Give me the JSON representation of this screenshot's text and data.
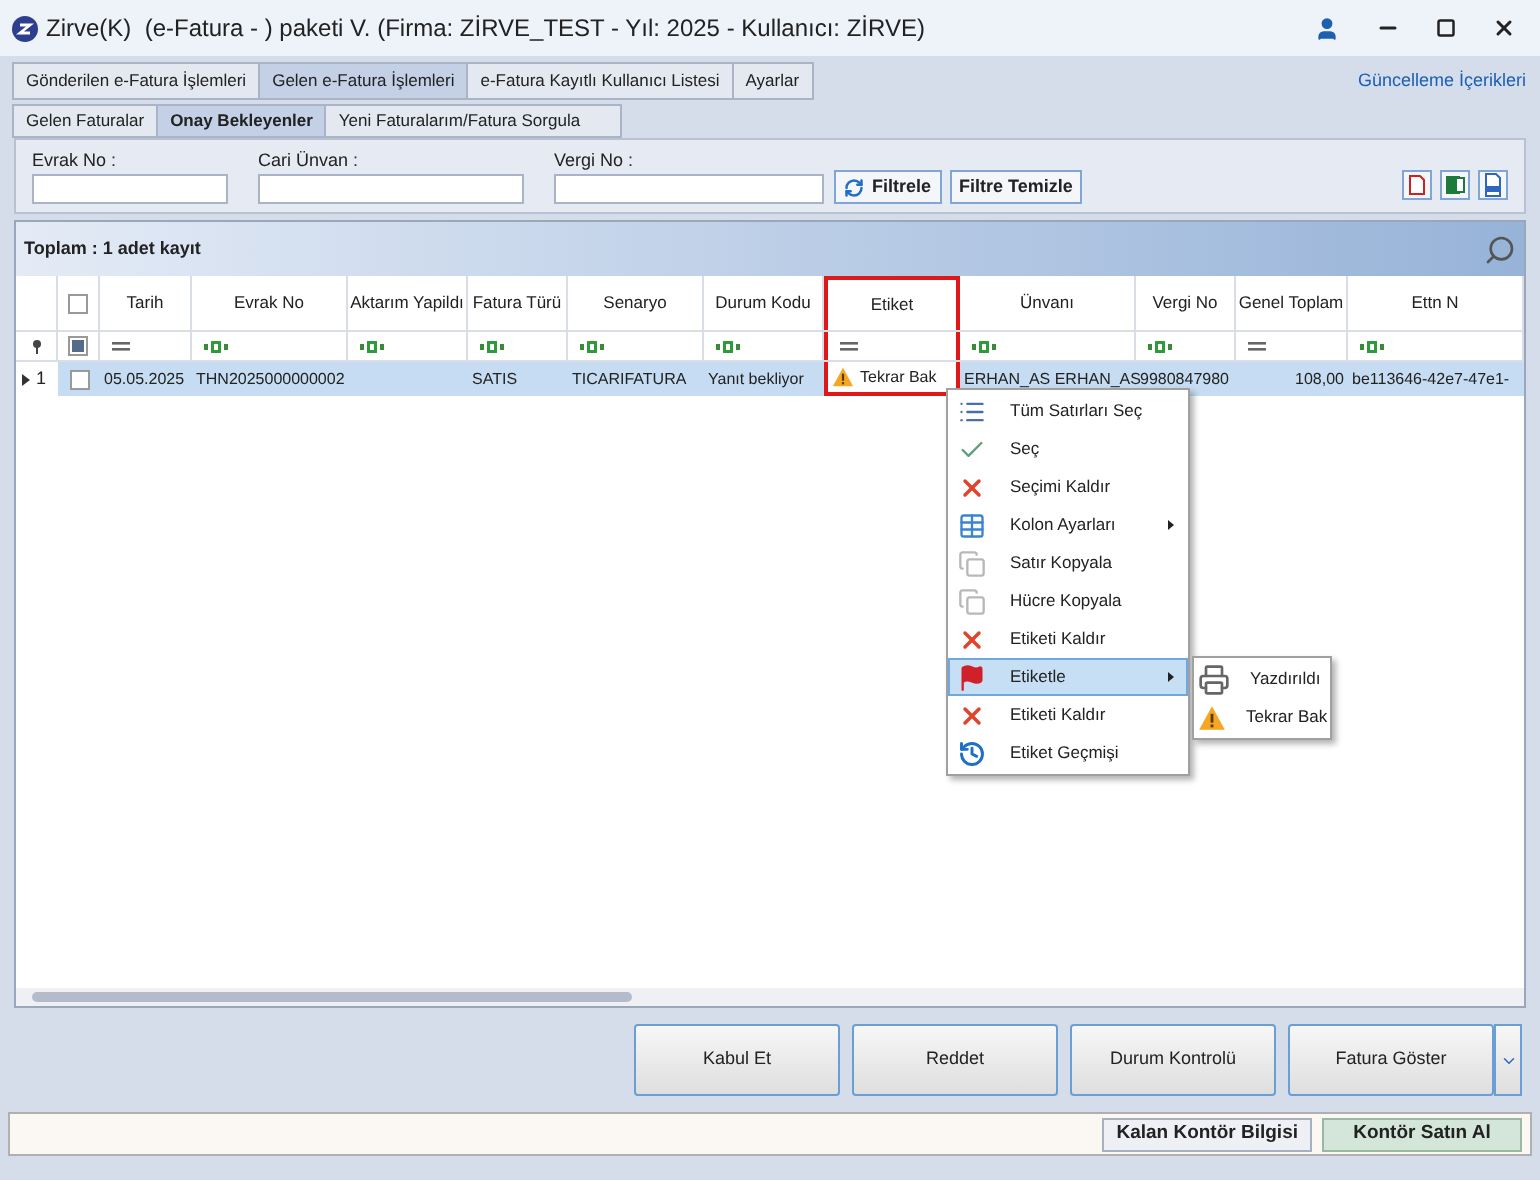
{
  "window": {
    "title": "Zirve(K)  (e-Fatura - ) paketi V. (Firma: ZİRVE_TEST - Yıl: 2025 - Kullanıcı: ZİRVE)"
  },
  "main_tabs": [
    {
      "label": "Gönderilen e-Fatura İşlemleri",
      "selected": false
    },
    {
      "label": "Gelen e-Fatura İşlemleri",
      "selected": true
    },
    {
      "label": "e-Fatura Kayıtlı Kullanıcı Listesi",
      "selected": false
    },
    {
      "label": "Ayarlar",
      "selected": false
    }
  ],
  "update_link": "Güncelleme İçerikleri",
  "sub_tabs": [
    {
      "label": "Gelen Faturalar",
      "selected": false
    },
    {
      "label": "Onay Bekleyenler",
      "selected": true
    },
    {
      "label": "Yeni Faturalarım/Fatura Sorgula",
      "selected": false
    }
  ],
  "filters": [
    {
      "label": "Evrak No :"
    },
    {
      "label": "Cari Ünvan :"
    },
    {
      "label": "Vergi No :"
    }
  ],
  "filter_buttons": [
    "Filtrele",
    "Filtre Temizle"
  ],
  "total": "Toplam : 1 adet kayıt",
  "select_all": {
    "checked": false
  },
  "filter_checkbox": {
    "checked": true
  },
  "columns": [
    {
      "label": "Tarih",
      "kind": "equals",
      "highlighted": false
    },
    {
      "label": "Evrak No",
      "kind": "text",
      "highlighted": false
    },
    {
      "label": "Aktarım Yapildı",
      "kind": "text",
      "highlighted": false
    },
    {
      "label": "Fatura Türü",
      "kind": "text",
      "highlighted": false
    },
    {
      "label": "Senaryo",
      "kind": "text",
      "highlighted": false
    },
    {
      "label": "Durum Kodu",
      "kind": "text",
      "highlighted": false
    },
    {
      "label": "Etiket",
      "kind": "equals",
      "highlighted": true
    },
    {
      "label": "Ünvanı",
      "kind": "text",
      "highlighted": false
    },
    {
      "label": "Vergi No",
      "kind": "text",
      "highlighted": false
    },
    {
      "label": "Genel Toplam",
      "kind": "equals",
      "highlighted": false
    },
    {
      "label": "Ettn N",
      "kind": "text",
      "highlighted": false
    }
  ],
  "rows": [
    {
      "number": "1",
      "selected": true,
      "checked": false,
      "cells": [
        "05.05.2025",
        "THN2025000000002",
        "",
        "SATIS",
        "TICARIFATURA",
        "Yanıt bekliyor",
        "Tekrar Bak",
        "ERHAN_AS ERHAN_AS",
        "9980847980",
        "108,00",
        "be113646-42e7-47e1-"
      ]
    }
  ],
  "context_menu": [
    {
      "label": "Tüm Satırları Seç",
      "kind": "list",
      "submenu": false,
      "selected": false
    },
    {
      "label": "Seç",
      "kind": "check",
      "submenu": false,
      "selected": false
    },
    {
      "label": "Seçimi Kaldır",
      "kind": "x",
      "submenu": false,
      "selected": false
    },
    {
      "label": "Kolon Ayarları",
      "kind": "table",
      "submenu": true,
      "selected": false
    },
    {
      "label": "Satır Kopyala",
      "kind": "copy",
      "submenu": false,
      "selected": false
    },
    {
      "label": "Hücre Kopyala",
      "kind": "copy",
      "submenu": false,
      "selected": false
    },
    {
      "label": "Etiketi Kaldır",
      "kind": "x",
      "submenu": false,
      "selected": false
    },
    {
      "label": "Etiketle",
      "kind": "flag",
      "submenu": true,
      "selected": true
    },
    {
      "label": "Etiketi Kaldır",
      "kind": "x",
      "submenu": false,
      "selected": false
    },
    {
      "label": "Etiket Geçmişi",
      "kind": "history",
      "submenu": false,
      "selected": false
    }
  ],
  "submenu": [
    {
      "label": "Yazdırıldı",
      "kind": "printer"
    },
    {
      "label": "Tekrar Bak",
      "kind": "warning"
    }
  ],
  "action_buttons": [
    "Kabul Et",
    "Reddet",
    "Durum Kontrolü",
    "Fatura Göster"
  ],
  "status_buttons": [
    {
      "label": "Kalan Kontör Bilgisi",
      "kind": "plain"
    },
    {
      "label": "Kontör Satın Al",
      "kind": "accent"
    }
  ]
}
